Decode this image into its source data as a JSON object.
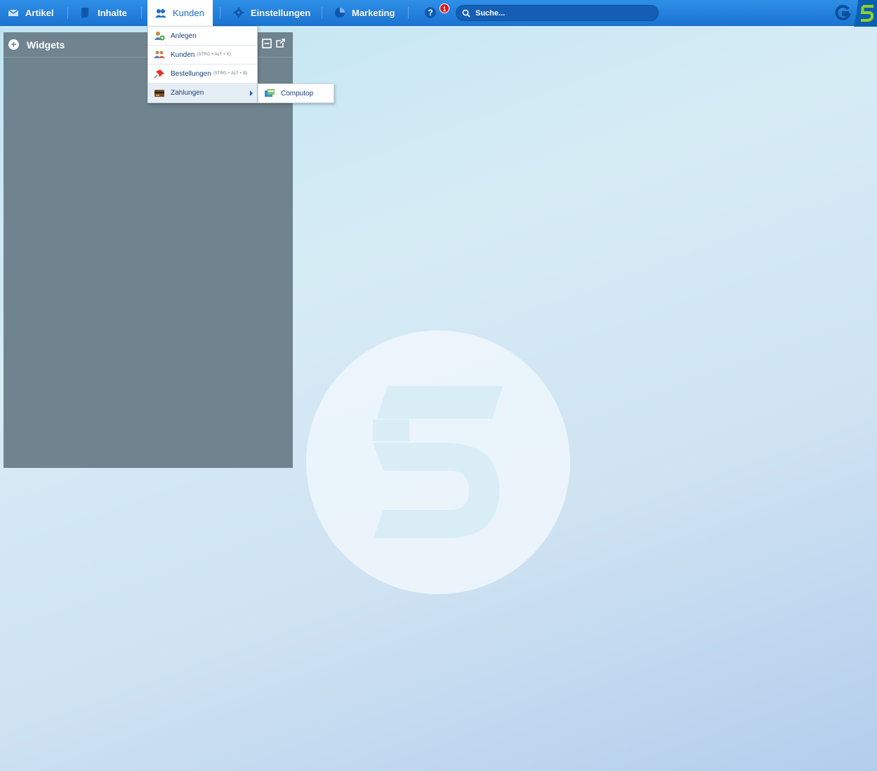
{
  "nav": {
    "artikel": "Artikel",
    "inhalte": "Inhalte",
    "kunden": "Kunden",
    "einstellungen": "Einstellungen",
    "marketing": "Marketing",
    "help": "?",
    "notification_count": "1"
  },
  "search": {
    "placeholder": "Suche..."
  },
  "widgets": {
    "title": "Widgets"
  },
  "menu": {
    "items": [
      {
        "label": "Anlegen",
        "shortcut": ""
      },
      {
        "label": "Kunden",
        "shortcut": "(STRG + ALT + K)"
      },
      {
        "label": "Bestellungen",
        "shortcut": "(STRG + ALT + B)"
      },
      {
        "label": "Zahlungen",
        "shortcut": ""
      }
    ],
    "submenu": {
      "label": "Computop"
    }
  },
  "colors": {
    "topbar": "#1f7fdb",
    "panel": "#6f848f",
    "menu_text": "#1b3f7a",
    "notif": "#e3151b",
    "brand_green": "#8fd12a"
  }
}
